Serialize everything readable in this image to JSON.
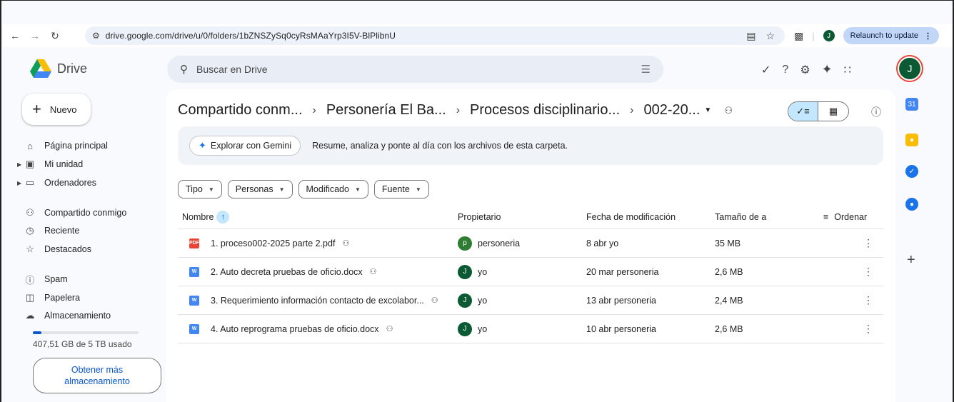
{
  "browser": {
    "url": "drive.google.com/drive/u/0/folders/1bZNSZySq0cyRsMAaYrp3I5V-BlPlibnU",
    "profile_initial": "J",
    "relaunch_label": "Relaunch to update"
  },
  "header": {
    "app_name": "Drive",
    "search_placeholder": "Buscar en Drive",
    "avatar_initial": "J"
  },
  "sidebar": {
    "new_label": "Nuevo",
    "items": [
      {
        "label": "Página principal",
        "icon": "home-icon"
      },
      {
        "label": "Mi unidad",
        "icon": "my-drive-icon"
      },
      {
        "label": "Ordenadores",
        "icon": "computer-icon"
      },
      {
        "label": "Compartido conmigo",
        "icon": "shared-icon"
      },
      {
        "label": "Reciente",
        "icon": "clock-icon"
      },
      {
        "label": "Destacados",
        "icon": "star-icon"
      },
      {
        "label": "Spam",
        "icon": "spam-icon"
      },
      {
        "label": "Papelera",
        "icon": "trash-icon"
      },
      {
        "label": "Almacenamiento",
        "icon": "cloud-icon"
      }
    ],
    "storage_used_fraction": 0.08,
    "storage_text": "407,51 GB de 5 TB usado",
    "more_storage_label": "Obtener más almacenamiento"
  },
  "breadcrumb": {
    "items": [
      "Compartido conm...",
      "Personería El Ba...",
      "Procesos disciplinario...",
      "002-20..."
    ]
  },
  "gemini": {
    "button_label": "Explorar con Gemini",
    "description": "Resume, analiza y ponte al día con los archivos de esta carpeta."
  },
  "filters": [
    "Tipo",
    "Personas",
    "Modificado",
    "Fuente"
  ],
  "table": {
    "headers": {
      "name": "Nombre",
      "owner": "Propietario",
      "modified": "Fecha de modificación",
      "size": "Tamaño de a",
      "sort": "Ordenar"
    },
    "rows": [
      {
        "name": "1. proceso002-2025 parte 2.pdf",
        "type": "pdf",
        "owner_initial": "p",
        "owner": "personeria",
        "modified": "8 abr yo",
        "size": "35 MB"
      },
      {
        "name": "2. Auto decreta pruebas de oficio.docx",
        "type": "doc",
        "owner_initial": "J",
        "owner": "yo",
        "modified": "20 mar personeria",
        "size": "2,6 MB"
      },
      {
        "name": "3. Requerimiento información contacto de excolabor...",
        "type": "doc",
        "owner_initial": "J",
        "owner": "yo",
        "modified": "13 abr personeria",
        "size": "2,4 MB"
      },
      {
        "name": "4. Auto reprograma pruebas de oficio.docx",
        "type": "doc",
        "owner_initial": "J",
        "owner": "yo",
        "modified": "10 abr personeria",
        "size": "2,6 MB"
      }
    ]
  },
  "icon_labels": {
    "pdf": "PDF",
    "doc": "W"
  }
}
